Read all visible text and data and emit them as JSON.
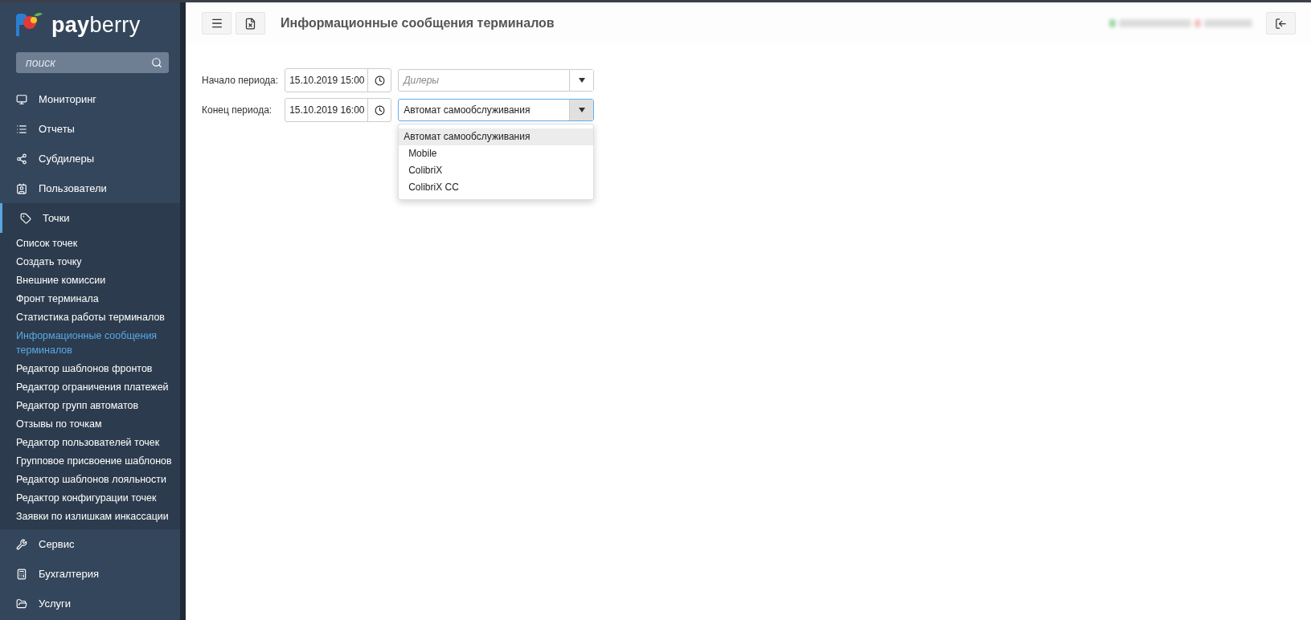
{
  "sidebar": {
    "brand": {
      "strong": "pay",
      "light": "berry"
    },
    "search": {
      "placeholder": "поиск"
    },
    "items": [
      {
        "label": "Мониторинг",
        "expanded": false
      },
      {
        "label": "Отчеты",
        "expanded": false
      },
      {
        "label": "Субдилеры",
        "expanded": false
      },
      {
        "label": "Пользователи",
        "expanded": false
      },
      {
        "label": "Точки",
        "expanded": true,
        "children": [
          {
            "label": "Список точек",
            "selected": false
          },
          {
            "label": "Создать точку",
            "selected": false
          },
          {
            "label": "Внешние комиссии",
            "selected": false
          },
          {
            "label": "Фронт терминала",
            "selected": false
          },
          {
            "label": "Статистика работы терминалов",
            "selected": false
          },
          {
            "label": "Информационные сообщения терминалов",
            "selected": true
          },
          {
            "label": "Редактор шаблонов фронтов",
            "selected": false
          },
          {
            "label": "Редактор ограничения платежей",
            "selected": false
          },
          {
            "label": "Редактор групп автоматов",
            "selected": false
          },
          {
            "label": "Отзывы по точкам",
            "selected": false
          },
          {
            "label": "Редактор пользователей точек",
            "selected": false
          },
          {
            "label": "Групповое присвоение шаблонов",
            "selected": false
          },
          {
            "label": "Редактор шаблонов лояльности",
            "selected": false
          },
          {
            "label": "Редактор конфигурации точек",
            "selected": false
          },
          {
            "label": "Заявки по излишкам инкассации",
            "selected": false
          }
        ]
      },
      {
        "label": "Сервис",
        "expanded": false
      },
      {
        "label": "Бухгалтерия",
        "expanded": false
      },
      {
        "label": "Услуги",
        "expanded": false
      }
    ]
  },
  "header": {
    "title": "Информационные сообщения терминалов"
  },
  "filters": [
    {
      "label": "Начало периода:",
      "date": "15.10.2019 15:00",
      "select": {
        "placeholder": "Дилеры",
        "open": false
      }
    },
    {
      "label": "Конец периода:",
      "date": "15.10.2019 16:00",
      "select": {
        "value": "Автомат самообслуживания",
        "open": true,
        "options": [
          {
            "label": "Автомат самообслуживания",
            "selected": true
          },
          {
            "label": "Mobile",
            "selected": false
          },
          {
            "label": "ColibriX",
            "selected": false
          },
          {
            "label": "ColibriX CC",
            "selected": false
          }
        ]
      }
    }
  ]
}
